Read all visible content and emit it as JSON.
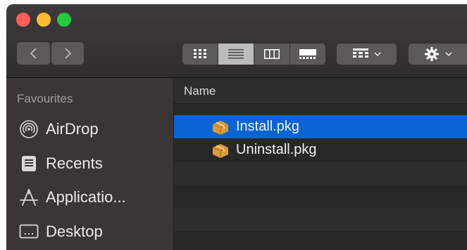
{
  "toolbar": {
    "traffic_lights": {
      "close_color": "#fe5f57",
      "minimize_color": "#febc2e",
      "maximize_color": "#28c840"
    },
    "view_modes": [
      "icon",
      "list",
      "column",
      "gallery"
    ],
    "active_view": "list",
    "icons": {
      "back": "chevron-left-icon",
      "forward": "chevron-right-icon",
      "group": "group-by-icon",
      "action": "gear-icon"
    }
  },
  "sidebar": {
    "section_title": "Favourites",
    "items": [
      {
        "label": "AirDrop",
        "icon": "airdrop-icon"
      },
      {
        "label": "Recents",
        "icon": "recents-icon"
      },
      {
        "label": "Applicatio...",
        "icon": "applications-icon"
      },
      {
        "label": "Desktop",
        "icon": "desktop-icon"
      }
    ]
  },
  "file_list": {
    "column_header": "Name",
    "files": [
      {
        "name": "Install.pkg",
        "icon": "package-icon",
        "selected": true
      },
      {
        "name": "Uninstall.pkg",
        "icon": "package-icon",
        "selected": false
      }
    ],
    "selection_color": "#0a64d2"
  }
}
